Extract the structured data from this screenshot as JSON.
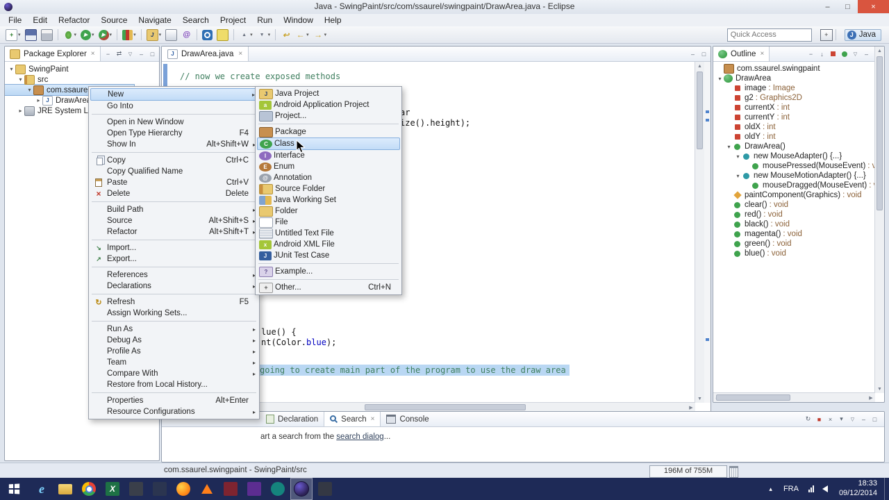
{
  "colors": {
    "taskbar": "#1e2a57",
    "menu_highlight": "#c2dcf7",
    "selection_blue": "#b9d7f3",
    "comment_green": "#3f7f5f",
    "field_blue": "#0000c0",
    "close_button_red": "#d9553f"
  },
  "window": {
    "title": "Java - SwingPaint/src/com/ssaurel/swingpaint/DrawArea.java - Eclipse"
  },
  "menubar": {
    "items": [
      "File",
      "Edit",
      "Refactor",
      "Source",
      "Navigate",
      "Search",
      "Project",
      "Run",
      "Window",
      "Help"
    ]
  },
  "toolbar": {
    "quick_access_placeholder": "Quick Access",
    "perspective_label": "Java",
    "buttons": [
      {
        "icon": "new-wizard-icon",
        "dd": true
      },
      {
        "icon": "save-icon"
      },
      {
        "icon": "print-icon"
      },
      {
        "sep": true
      },
      {
        "icon": "debug-icon",
        "dd": true
      },
      {
        "icon": "run-icon",
        "dd": true
      },
      {
        "icon": "external-tools-icon",
        "dd": true
      },
      {
        "sep": true
      },
      {
        "icon": "coverage-icon",
        "dd": true
      },
      {
        "sep": true
      },
      {
        "icon": "new-java-project-icon",
        "dd": true
      },
      {
        "icon": "jar-icon"
      },
      {
        "icon": "javadoc-icon"
      },
      {
        "sep": true
      },
      {
        "icon": "search-toolbar-icon"
      },
      {
        "icon": "mark-occurrences-icon"
      },
      {
        "sep": true
      },
      {
        "icon": "prev-annotation-icon",
        "dd": true
      },
      {
        "icon": "next-annotation-icon",
        "dd": true
      },
      {
        "sep": true
      },
      {
        "icon": "last-edit-icon"
      },
      {
        "icon": "back-icon",
        "dd": true
      },
      {
        "icon": "forward-icon",
        "dd": true
      }
    ]
  },
  "package_explorer": {
    "title": "Package Explorer",
    "tree": [
      {
        "label": "SwingPaint",
        "icon": "project-icon",
        "level": 0,
        "expand": "expanded"
      },
      {
        "label": "src",
        "icon": "source-folder-icon",
        "level": 1,
        "expand": "expanded"
      },
      {
        "label": "com.ssaurel.swingpaint",
        "icon": "package-icon",
        "level": 2,
        "expand": "expanded",
        "selected": true
      },
      {
        "label": "DrawArea",
        "icon": "java-file-icon",
        "level": 3,
        "expand": "collapsed"
      },
      {
        "label": "JRE System Libra",
        "icon": "library-icon",
        "level": 1,
        "expand": "collapsed"
      }
    ]
  },
  "editor": {
    "tab_label": "DrawArea.java",
    "fragments": {
      "comment_top": "// now we create exposed methods",
      "mid_a": "ar",
      "mid_b": "ize().height);",
      "low_a": "lue() {",
      "low_b_pre": "nt(Color.",
      "low_b_field": "blue",
      "low_b_post": ");",
      "selected_line": "going to create main part of the program to use the draw area"
    }
  },
  "context_menu": {
    "items": [
      {
        "label": "New",
        "submenu": true,
        "highlighted": true
      },
      {
        "label": "Go Into"
      },
      {
        "sep": true
      },
      {
        "label": "Open in New Window"
      },
      {
        "label": "Open Type Hierarchy",
        "shortcut": "F4"
      },
      {
        "label": "Show In",
        "shortcut": "Alt+Shift+W",
        "submenu": true
      },
      {
        "sep": true
      },
      {
        "label": "Copy",
        "shortcut": "Ctrl+C",
        "icon": "copy-icon"
      },
      {
        "label": "Copy Qualified Name"
      },
      {
        "label": "Paste",
        "shortcut": "Ctrl+V",
        "icon": "paste-icon"
      },
      {
        "label": "Delete",
        "shortcut": "Delete",
        "icon": "delete-icon"
      },
      {
        "sep": true
      },
      {
        "label": "Build Path",
        "submenu": true
      },
      {
        "label": "Source",
        "shortcut": "Alt+Shift+S",
        "submenu": true
      },
      {
        "label": "Refactor",
        "shortcut": "Alt+Shift+T",
        "submenu": true
      },
      {
        "sep": true
      },
      {
        "label": "Import...",
        "icon": "import-icon"
      },
      {
        "label": "Export...",
        "icon": "export-icon"
      },
      {
        "sep": true
      },
      {
        "label": "References",
        "submenu": true
      },
      {
        "label": "Declarations",
        "submenu": true
      },
      {
        "sep": true
      },
      {
        "label": "Refresh",
        "shortcut": "F5",
        "icon": "refresh-icon"
      },
      {
        "label": "Assign Working Sets..."
      },
      {
        "sep": true
      },
      {
        "label": "Run As",
        "submenu": true
      },
      {
        "label": "Debug As",
        "submenu": true
      },
      {
        "label": "Profile As",
        "submenu": true
      },
      {
        "label": "Team",
        "submenu": true
      },
      {
        "label": "Compare With",
        "submenu": true
      },
      {
        "label": "Restore from Local History..."
      },
      {
        "sep": true
      },
      {
        "label": "Properties",
        "shortcut": "Alt+Enter"
      },
      {
        "label": "Resource Configurations",
        "submenu": true
      }
    ]
  },
  "new_submenu": {
    "items": [
      {
        "label": "Java Project",
        "icon": "java-project-icon"
      },
      {
        "label": "Android Application Project",
        "icon": "android-project-icon"
      },
      {
        "label": "Project...",
        "icon": "project-generic-icon"
      },
      {
        "sep": true
      },
      {
        "label": "Package",
        "icon": "package-new-icon"
      },
      {
        "label": "Class",
        "icon": "class-new-icon",
        "highlighted": true
      },
      {
        "label": "Interface",
        "icon": "interface-new-icon"
      },
      {
        "label": "Enum",
        "icon": "enum-new-icon"
      },
      {
        "label": "Annotation",
        "icon": "annotation-new-icon"
      },
      {
        "label": "Source Folder",
        "icon": "source-folder-new-icon"
      },
      {
        "label": "Java Working Set",
        "icon": "working-set-icon"
      },
      {
        "label": "Folder",
        "icon": "folder-new-icon"
      },
      {
        "label": "File",
        "icon": "file-new-icon"
      },
      {
        "label": "Untitled Text File",
        "icon": "text-file-icon"
      },
      {
        "label": "Android XML File",
        "icon": "android-xml-icon"
      },
      {
        "label": "JUnit Test Case",
        "icon": "junit-icon"
      },
      {
        "sep": true
      },
      {
        "label": "Example...",
        "icon": "example-icon"
      },
      {
        "sep": true
      },
      {
        "label": "Other...",
        "shortcut": "Ctrl+N",
        "icon": "other-icon"
      }
    ]
  },
  "outline": {
    "title": "Outline",
    "tree": [
      {
        "label": "com.ssaurel.swingpaint",
        "icon": "package-icon",
        "level": 0
      },
      {
        "label": "DrawArea",
        "icon": "class-icon",
        "level": 0,
        "expand": "expanded"
      },
      {
        "label": "image",
        "type": ": Image",
        "icon": "field-icon",
        "level": 1
      },
      {
        "label": "g2",
        "type": ": Graphics2D",
        "icon": "field-icon",
        "level": 1
      },
      {
        "label": "currentX",
        "type": ": int",
        "icon": "field-icon",
        "level": 1
      },
      {
        "label": "currentY",
        "type": ": int",
        "icon": "field-icon",
        "level": 1
      },
      {
        "label": "oldX",
        "type": ": int",
        "icon": "field-icon",
        "level": 1
      },
      {
        "label": "oldY",
        "type": ": int",
        "icon": "field-icon",
        "level": 1
      },
      {
        "label": "DrawArea()",
        "icon": "constructor-icon",
        "level": 1,
        "expand": "expanded"
      },
      {
        "label": "new MouseAdapter() {...}",
        "icon": "anonymous-class-icon",
        "level": 2,
        "expand": "expanded"
      },
      {
        "label": "mousePressed(MouseEvent)",
        "type": ": void",
        "icon": "method-icon",
        "level": 3
      },
      {
        "label": "new MouseMotionAdapter() {...}",
        "icon": "anonymous-class-icon",
        "level": 2,
        "expand": "expanded"
      },
      {
        "label": "mouseDragged(MouseEvent)",
        "type": ": void",
        "icon": "method-icon",
        "level": 3
      },
      {
        "label": "paintComponent(Graphics)",
        "type": ": void",
        "icon": "method-override-icon",
        "level": 1
      },
      {
        "label": "clear()",
        "type": ": void",
        "icon": "method-icon",
        "level": 1
      },
      {
        "label": "red()",
        "type": ": void",
        "icon": "method-icon",
        "level": 1
      },
      {
        "label": "black()",
        "type": ": void",
        "icon": "method-icon",
        "level": 1
      },
      {
        "label": "magenta()",
        "type": ": void",
        "icon": "method-icon",
        "level": 1
      },
      {
        "label": "green()",
        "type": ": void",
        "icon": "method-icon",
        "level": 1
      },
      {
        "label": "blue()",
        "type": ": void",
        "icon": "method-icon",
        "level": 1
      }
    ]
  },
  "bottom_panel": {
    "tabs": [
      {
        "label": "Declaration",
        "icon": "declaration-icon"
      },
      {
        "label": "Search",
        "icon": "search-tab-icon",
        "active": true
      },
      {
        "label": "Console",
        "icon": "console-icon"
      }
    ],
    "message_pre": "art a search from the ",
    "message_link": "search dialog",
    "message_post": "..."
  },
  "status_bar": {
    "left": "com.ssaurel.swingpaint - SwingPaint/src",
    "heap": "196M of 755M"
  },
  "taskbar": {
    "language": "FRA",
    "time": "18:33",
    "date": "09/12/2014",
    "apps": [
      {
        "icon": "internet-explorer-icon"
      },
      {
        "icon": "file-explorer-icon"
      },
      {
        "icon": "chrome-icon"
      },
      {
        "icon": "excel-icon"
      },
      {
        "icon": "dark-app-icon"
      },
      {
        "icon": "dark-app2-icon"
      },
      {
        "icon": "firefox-icon"
      },
      {
        "icon": "vlc-icon"
      },
      {
        "icon": "red-app-icon"
      },
      {
        "icon": "purple-app-icon"
      },
      {
        "icon": "media-app-icon"
      },
      {
        "icon": "eclipse-icon",
        "active": true
      },
      {
        "icon": "dark-app3-icon"
      }
    ]
  }
}
